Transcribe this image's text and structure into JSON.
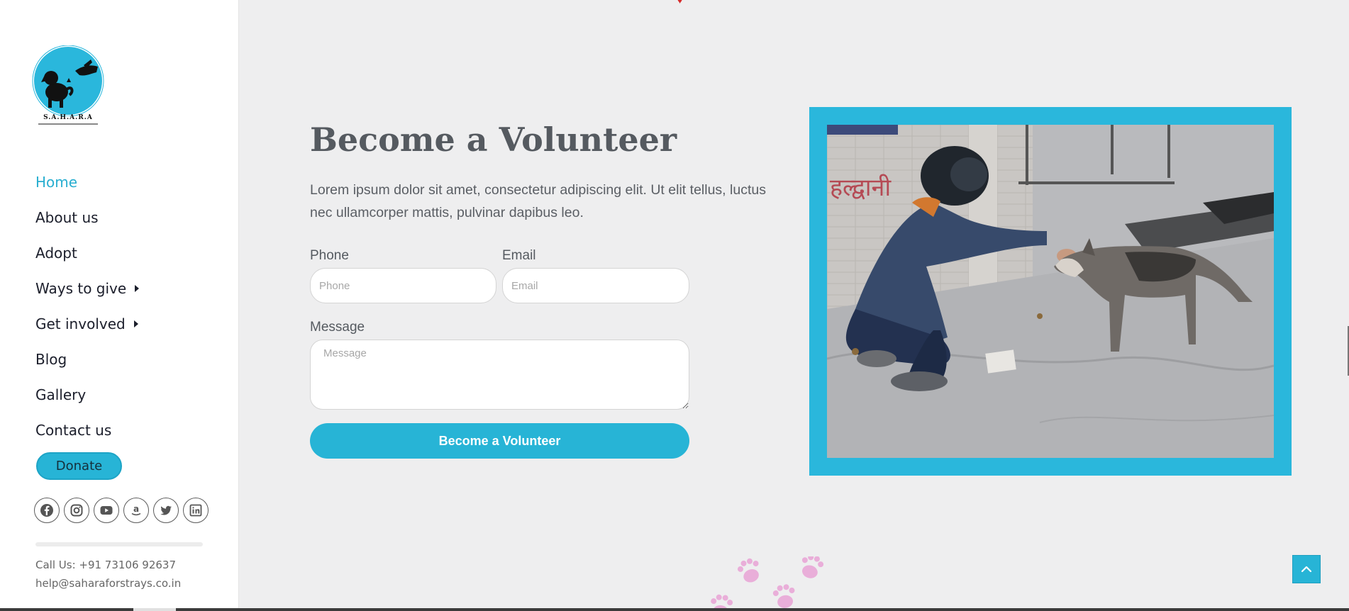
{
  "logo": {
    "text": "S.A.H.A.R.A",
    "icon": "sahara-dog-hand-logo"
  },
  "nav": {
    "items": [
      {
        "label": "Home",
        "active": true
      },
      {
        "label": "About us"
      },
      {
        "label": "Adopt"
      },
      {
        "label": "Ways to give",
        "has_submenu": true
      },
      {
        "label": "Get involved",
        "has_submenu": true
      },
      {
        "label": "Blog"
      },
      {
        "label": "Gallery"
      },
      {
        "label": "Contact us"
      }
    ]
  },
  "donate": {
    "label": "Donate"
  },
  "socials": [
    "facebook-icon",
    "instagram-icon",
    "youtube-icon",
    "amazon-icon",
    "twitter-icon",
    "linkedin-icon"
  ],
  "contact": {
    "phone": "Call Us: +91 73106 92637",
    "email": "help@saharaforstrays.co.in"
  },
  "volunteer": {
    "title": "Become a Volunteer",
    "lead": "Lorem ipsum dolor sit amet, consectetur adipiscing elit. Ut elit tellus, luctus nec ullamcorper mattis, pulvinar dapibus leo.",
    "phone_label": "Phone",
    "phone_placeholder": "Phone",
    "email_label": "Email",
    "email_placeholder": "Email",
    "message_label": "Message",
    "message_placeholder": "Message",
    "submit_label": "Become a Volunteer"
  },
  "colors": {
    "accent": "#27b4d6",
    "active_nav": "#28aed0",
    "page_bg": "#eeeeef",
    "title": "#555a60"
  }
}
